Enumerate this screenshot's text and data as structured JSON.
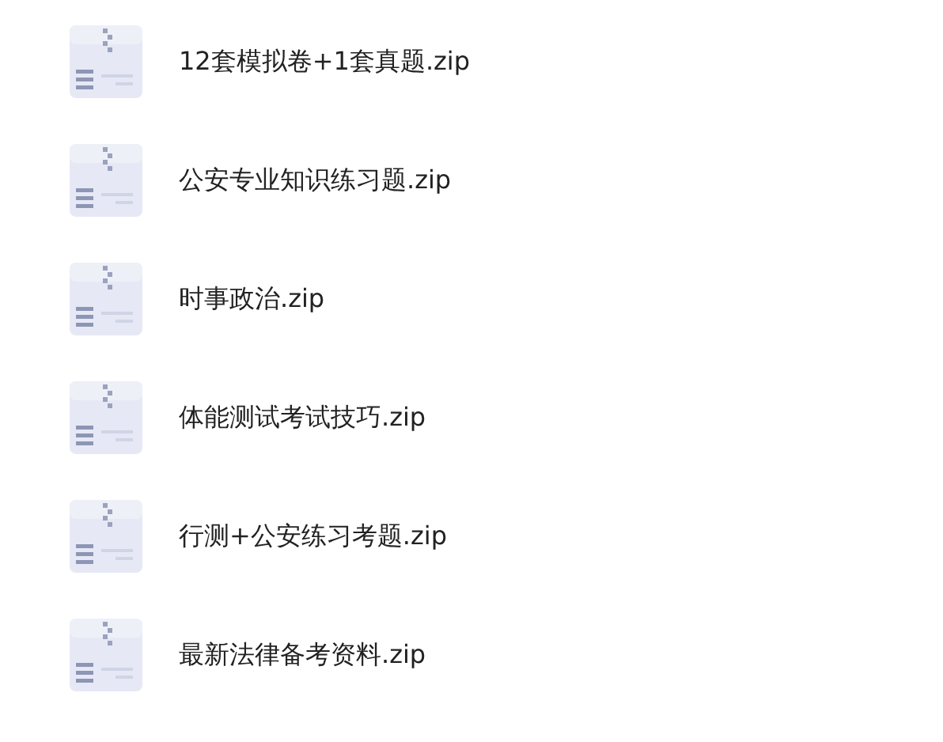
{
  "files": [
    {
      "name": "12套模拟卷+1套真题.zip"
    },
    {
      "name": "公安专业知识练习题.zip"
    },
    {
      "name": "时事政治.zip"
    },
    {
      "name": "体能测试考试技巧.zip"
    },
    {
      "name": "行测+公安练习考题.zip"
    },
    {
      "name": "最新法律备考资料.zip"
    }
  ]
}
